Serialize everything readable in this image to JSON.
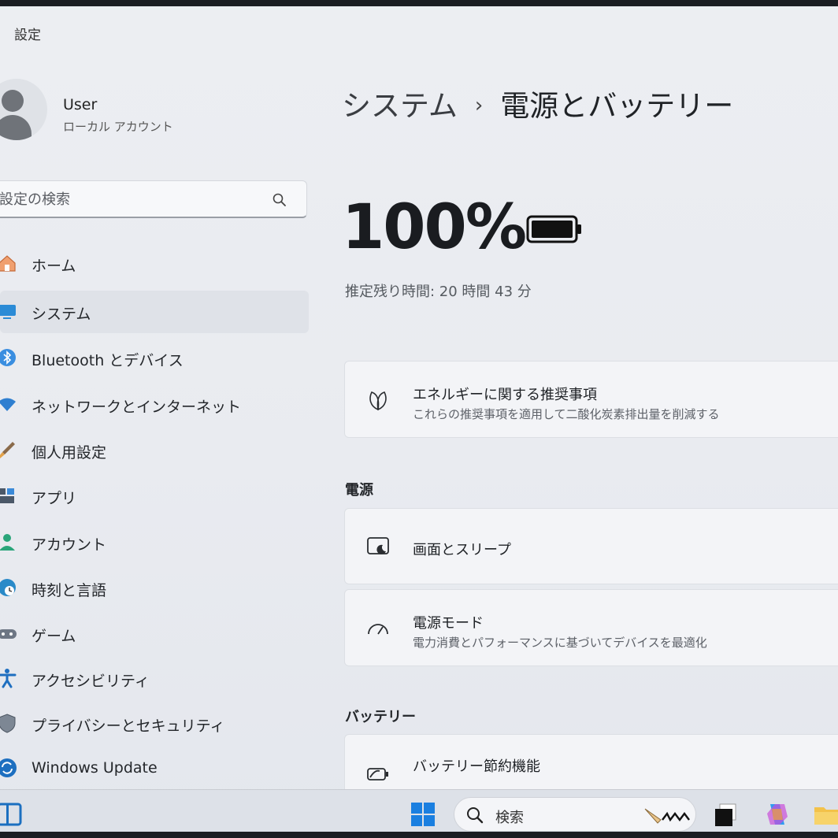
{
  "app": {
    "title": "設定"
  },
  "user": {
    "name": "User",
    "account_type": "ローカル アカウント"
  },
  "search": {
    "placeholder": "設定の検索"
  },
  "nav": {
    "items": [
      {
        "label": "ホーム",
        "icon": "home-icon",
        "selected": false
      },
      {
        "label": "システム",
        "icon": "system-icon",
        "selected": true
      },
      {
        "label": "Bluetooth とデバイス",
        "icon": "bluetooth-icon",
        "selected": false
      },
      {
        "label": "ネットワークとインターネット",
        "icon": "wifi-icon",
        "selected": false
      },
      {
        "label": "個人用設定",
        "icon": "brush-icon",
        "selected": false
      },
      {
        "label": "アプリ",
        "icon": "apps-icon",
        "selected": false
      },
      {
        "label": "アカウント",
        "icon": "account-icon",
        "selected": false
      },
      {
        "label": "時刻と言語",
        "icon": "time-language-icon",
        "selected": false
      },
      {
        "label": "ゲーム",
        "icon": "gamepad-icon",
        "selected": false
      },
      {
        "label": "アクセシビリティ",
        "icon": "accessibility-icon",
        "selected": false
      },
      {
        "label": "プライバシーとセキュリティ",
        "icon": "shield-icon",
        "selected": false
      },
      {
        "label": "Windows Update",
        "icon": "update-icon",
        "selected": false
      }
    ]
  },
  "breadcrumb": {
    "parent": "システム",
    "separator": "›",
    "current": "電源とバッテリー"
  },
  "battery": {
    "percent_label": "100%",
    "level": 1.0,
    "remaining_label": "推定残り時間: 20 時間 43 分"
  },
  "cards": {
    "energy": {
      "title": "エネルギーに関する推奨事項",
      "subtitle": "これらの推奨事項を適用して二酸化炭素排出量を削減する",
      "icon": "leaf-icon"
    },
    "screen_sleep": {
      "title": "画面とスリープ",
      "icon": "screen-sleep-icon"
    },
    "power_mode": {
      "title": "電源モード",
      "subtitle": "電力消費とパフォーマンスに基づいてデバイスを最適化",
      "icon": "gauge-icon"
    },
    "battery_saver": {
      "title": "バッテリー節約機能",
      "icon": "battery-saver-icon"
    }
  },
  "sections": {
    "power": "電源",
    "battery": "バッテリー"
  },
  "taskbar": {
    "search_label": "検索",
    "apps": [
      "widgets-icon",
      "start-icon",
      "search-icon",
      "app-black-icon",
      "copilot-icon",
      "file-explorer-icon"
    ]
  },
  "colors": {
    "accent": "#0067c0",
    "selected_bg": "#dfe2e8"
  }
}
